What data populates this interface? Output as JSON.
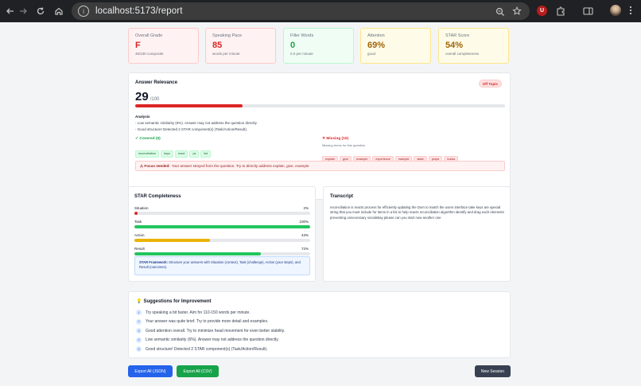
{
  "browser": {
    "url": "localhost:5173/report"
  },
  "metrics": [
    {
      "label": "Overall Grade",
      "value": "F",
      "sub": "46/100 composite",
      "bg": "#fef2f2",
      "border": "#fecaca",
      "color": "#dc2626"
    },
    {
      "label": "Speaking Pace",
      "value": "85",
      "sub": "words per minute",
      "bg": "#fef2f2",
      "border": "#fecaca",
      "color": "#dc2626"
    },
    {
      "label": "Filler Words",
      "value": "0",
      "sub": "0.0 per minute",
      "bg": "#f0fdf4",
      "border": "#bbf7d0",
      "color": "#16a34a"
    },
    {
      "label": "Attention",
      "value": "69%",
      "sub": "good",
      "bg": "#fefce8",
      "border": "#fde68a",
      "color": "#a16207"
    },
    {
      "label": "STAR Score",
      "value": "54%",
      "sub": "overall completeness",
      "bg": "#fefce8",
      "border": "#fde68a",
      "color": "#a16207"
    }
  ],
  "relevance": {
    "title": "Answer Relevance",
    "badge": "Off Topic",
    "score": "29",
    "score_suffix": "/100",
    "score_fraction": 0.29,
    "analysis_title": "Analysis",
    "analysis": [
      "- Low semantic similarity (6%). Answer may not address the question directly.",
      "- Good structure! Detected 2 STAR component(s) (Task/Action/Result)."
    ],
    "covered_title": "✓ Covered (5)",
    "covered": [
      "reconciliation",
      "keys",
      "react",
      "ps",
      "list"
    ],
    "missing_title": "✕ Missing (10)",
    "missing_sub": "Missing terms for this question",
    "missing": [
      "explain",
      "give",
      "example",
      "experience",
      "rsample",
      "state",
      "props",
      "hooks"
    ],
    "focus_label": "⚠ Focus needed:",
    "focus_text": "Your answer strayed from the question. Try to directly address explain, give, example"
  },
  "star": {
    "title": "STAR Completeness",
    "items": [
      {
        "label": "Situation",
        "pct": "2%",
        "value": 0.02,
        "color": "#dc2626"
      },
      {
        "label": "Task",
        "pct": "100%",
        "value": 1.0,
        "color": "#22c55e"
      },
      {
        "label": "Action",
        "pct": "43%",
        "value": 0.43,
        "color": "#eab308"
      },
      {
        "label": "Result",
        "pct": "72%",
        "value": 0.72,
        "color": "#22c55e"
      }
    ],
    "framework_label": "STAR Framework:",
    "framework_text": "Structure your answers with Situation (context), Task (challenge), Action (your steps), and Result (outcomes)."
  },
  "transcript": {
    "title": "Transcript",
    "text": "reconciliation is reacts process for efficiently updating the Dom to match the users interface take keys are special string that you must include for items in a list to help reacts reconciliation algorithm identify and drag each elements preventing unnecessary socialskay please can you start now another one"
  },
  "suggestions": {
    "title": "Suggestions for Improvement",
    "items": [
      "Try speaking a bit faster. Aim for 110-150 words per minute.",
      "Your answer was quite brief. Try to provide more detail and examples.",
      "Good attention overall. Try to minimize head movement for even better stability.",
      "Low semantic similarity (6%). Answer may not address the question directly.",
      "Good structure! Detected 2 STAR component(s) (Task/Action/Result)."
    ],
    "numbers": [
      "1",
      "2",
      "3",
      "4",
      "5"
    ]
  },
  "actions": {
    "export_json": "Export All (JSON)",
    "export_csv": "Export All (CSV)",
    "new_session": "New Session"
  }
}
